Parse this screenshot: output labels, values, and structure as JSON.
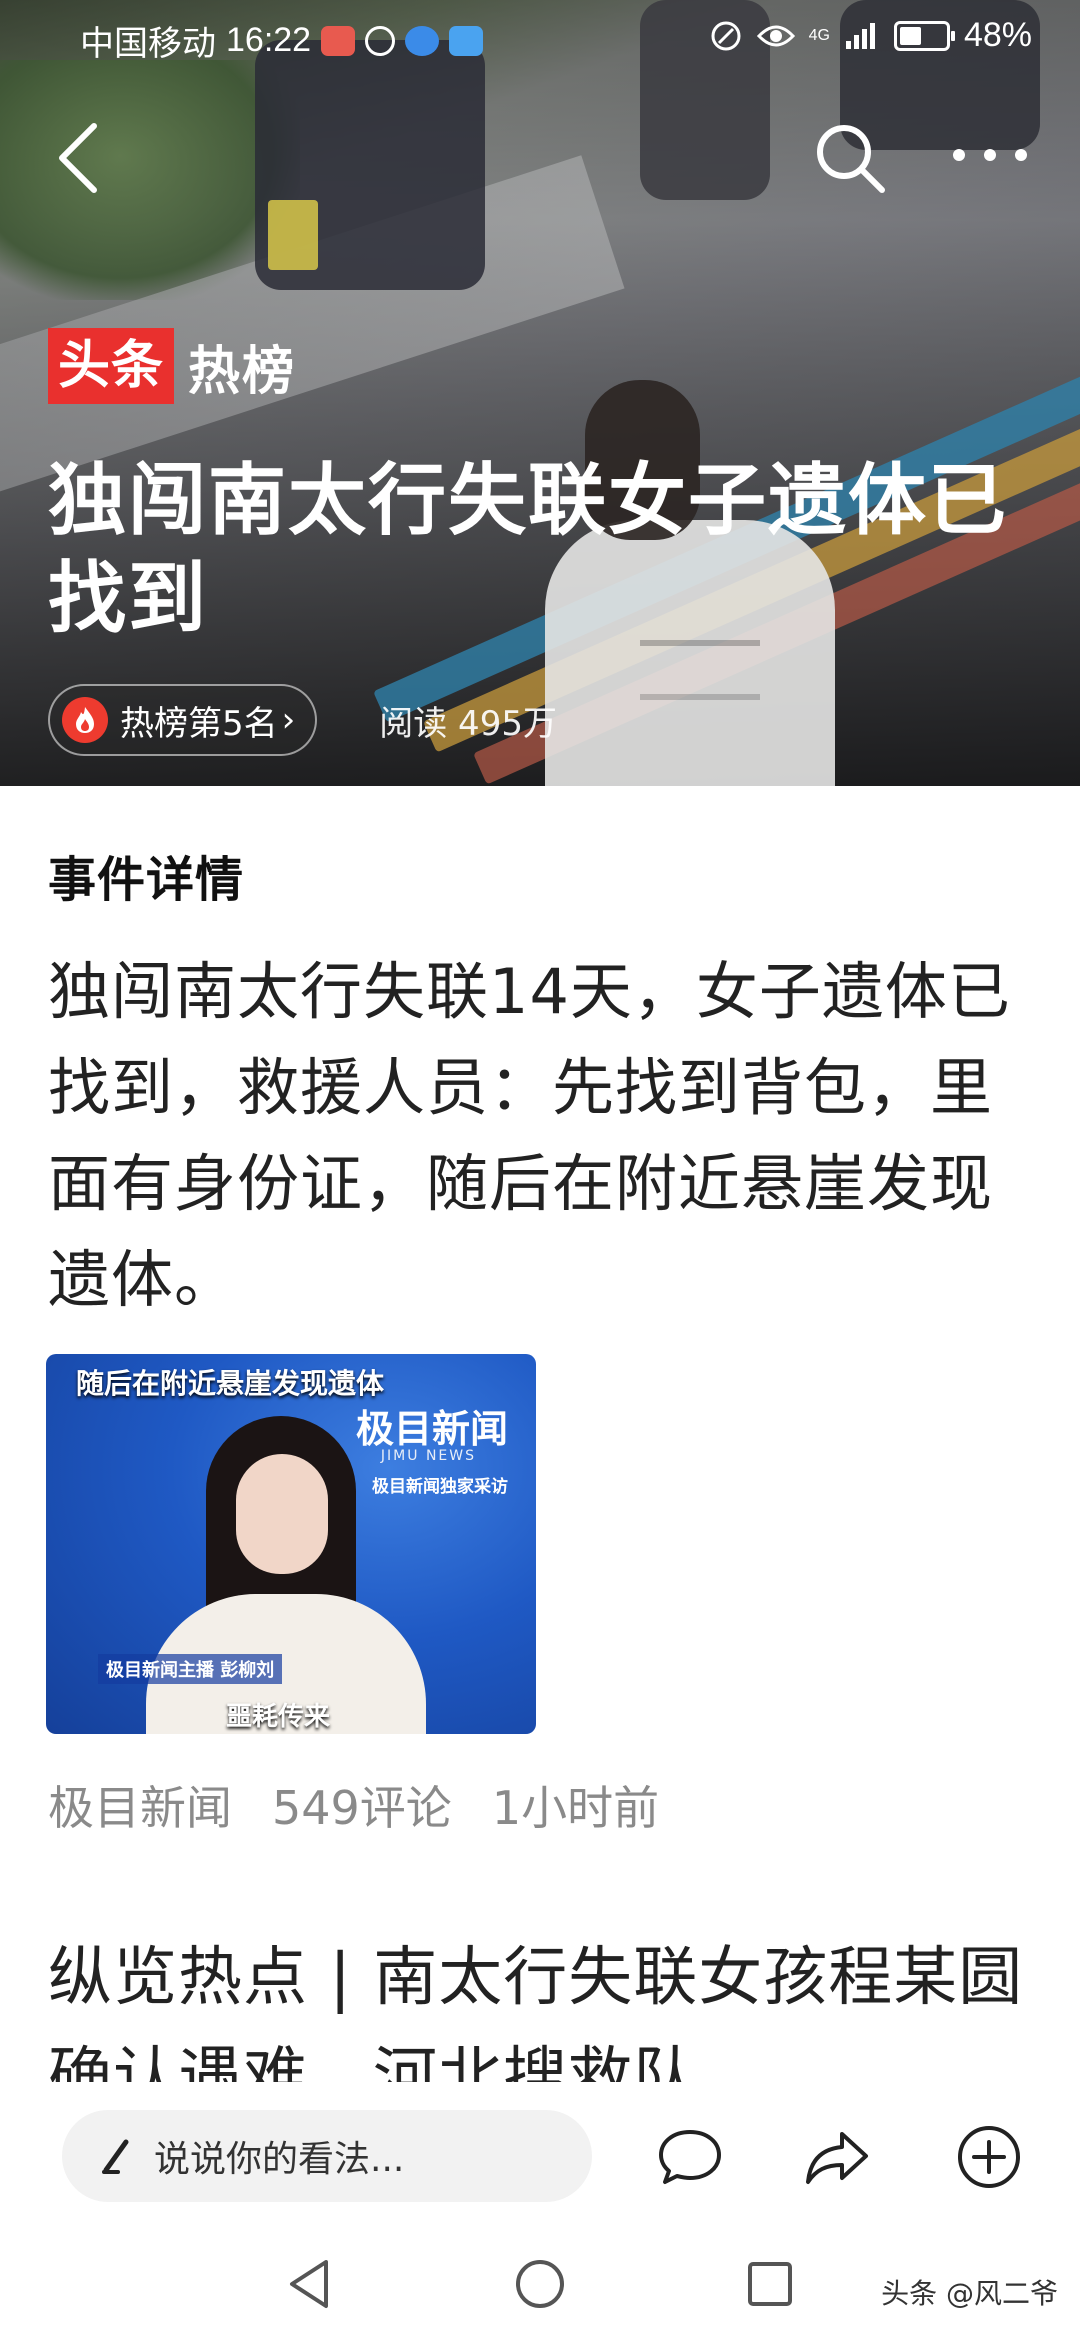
{
  "status_bar": {
    "carrier": "中国移动",
    "time": "16:22",
    "network": "4G",
    "battery_percent": "48%",
    "battery_level": 0.48
  },
  "nav": {
    "back_icon": "chevron-left-icon",
    "search_icon": "search-icon",
    "more_icon": "more-dots-icon"
  },
  "hero": {
    "brand_red": "头条",
    "brand_white": "热榜",
    "title": "独闯南太行失联女子遗体已找到",
    "rank_label": "热榜第5名",
    "rank_chevron": "›",
    "reads": "阅读 495万"
  },
  "content": {
    "section_heading": "事件详情",
    "detail_text": "独闯南太行失联14天，女子遗体已找到，救援人员：先找到背包，里面有身份证，随后在附近悬崖发现遗体。",
    "video": {
      "caption": "随后在附近悬崖发现遗体",
      "logo": "极目新闻",
      "logo_sub": "JIMU NEWS",
      "exclusive": "极目新闻独家采访",
      "lower_third": "极目新闻主播 彭柳刘",
      "bottom_text": "噩耗传来"
    },
    "source": "极目新闻",
    "comments": "549评论",
    "time_ago": "1小时前",
    "related_title": "纵览热点 | 南太行失联女孩程某圆确认遇难，河北搜救队"
  },
  "bottom_bar": {
    "comment_placeholder": "说说你的看法...",
    "comment_icon": "comment-icon",
    "share_icon": "share-icon",
    "add_icon": "plus-circle-icon"
  },
  "watermark": "头条 @风二爷",
  "colors": {
    "brand_red": "#e9302e",
    "rank_icon_red": "#ee3b2f",
    "meta_gray": "#8a8a8a"
  }
}
